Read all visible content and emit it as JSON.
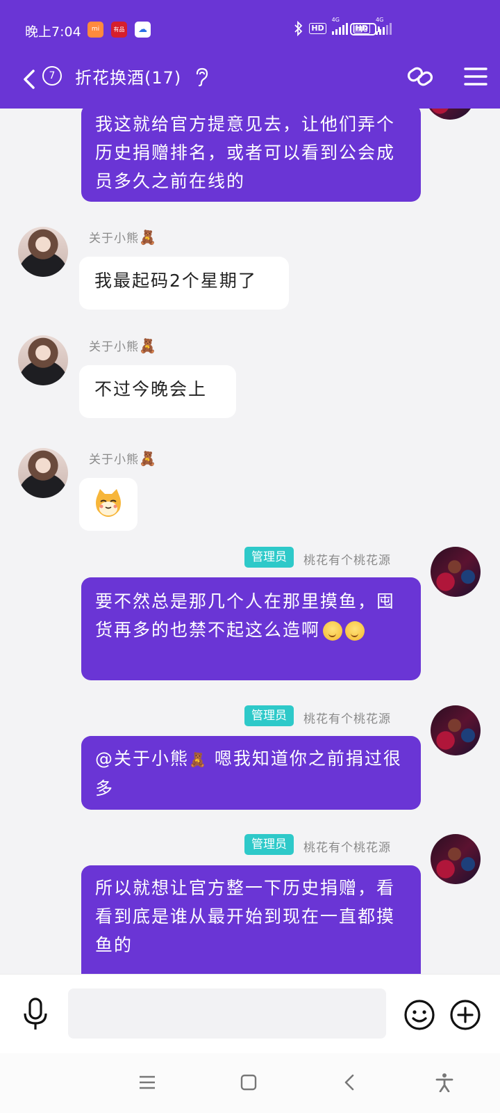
{
  "status_bar": {
    "time": "晚上7:04",
    "app_icon_mi": "mi",
    "app_icon_red": "有品",
    "hd_1": "HD",
    "net_1": "4G",
    "hd_2": "HD",
    "net_2": "4G",
    "battery": "45",
    "battery_level": 0.45
  },
  "header": {
    "unread_count": "7",
    "title": "折花换酒(17)"
  },
  "messages": [
    {
      "direction": "out",
      "text": "我这就给官方提意见去，让他们弄个历史捐赠排名，或者可以看到公会成员多久之前在线的"
    },
    {
      "direction": "in",
      "sender": "关于小熊",
      "sender_emoji": "🧸",
      "text": "我最起码2个星期了"
    },
    {
      "direction": "in",
      "sender": "关于小熊",
      "sender_emoji": "🧸",
      "text": "不过今晚会上"
    },
    {
      "direction": "in",
      "sender": "关于小熊",
      "sender_emoji": "🧸",
      "sticker": "cat-face-sticker"
    },
    {
      "direction": "out",
      "role": "管理员",
      "sender": "桃花有个桃花源",
      "text": "要不然总是那几个人在那里摸鱼，囤货再多的也禁不起这么造啊"
    },
    {
      "direction": "out",
      "role": "管理员",
      "sender": "桃花有个桃花源",
      "mention": "@关于小熊",
      "mention_emoji": "🧸",
      "text": " 嗯我知道你之前捐过很多"
    },
    {
      "direction": "out",
      "role": "管理员",
      "sender": "桃花有个桃花源",
      "text": "所以就想让官方整一下历史捐赠，看看到底是谁从最开始到现在一直都摸鱼的"
    }
  ],
  "input_bar": {
    "placeholder": ""
  },
  "colors": {
    "brand": "#6a35d5",
    "role_tag": "#2ec9c9",
    "background": "#f3f3f5"
  }
}
